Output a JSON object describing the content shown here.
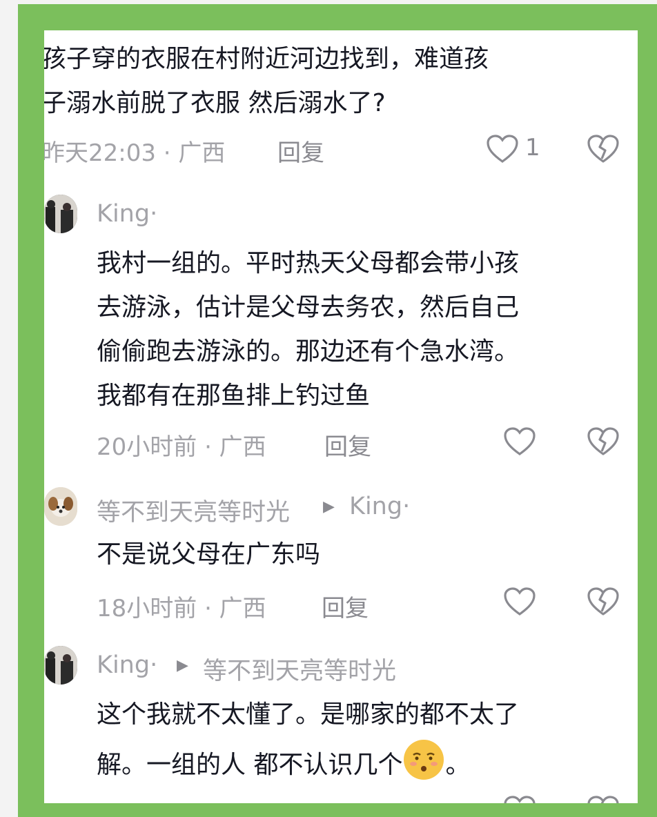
{
  "top_comment": {
    "text_line1": "孩子穿的衣服在村附近河边找到，难道孩",
    "text_line2": "子溺水前脱了衣服 然后溺水了?",
    "time_location": "昨天22:03 · 广西",
    "reply_label": "回复",
    "like_count": "1"
  },
  "replies": [
    {
      "username": "King·",
      "lines": [
        "我村一组的。平时热天父母都会带小孩",
        "去游泳，估计是父母去务农，然后自己",
        "偷偷跑去游泳的。那边还有个急水湾。",
        "我都有在那鱼排上钓过鱼"
      ],
      "time_location": "20小时前 · 广西",
      "reply_label": "回复"
    },
    {
      "username": "等不到天亮等时光",
      "reply_to": "King·",
      "lines": [
        "不是说父母在广东吗"
      ],
      "time_location": "18小时前 · 广西",
      "reply_label": "回复"
    },
    {
      "username": "King·",
      "reply_to": "等不到天亮等时光",
      "lines": [
        "这个我就不太懂了。是哪家的都不太了",
        "解。一组的人 都不认识几个",
        "。"
      ]
    }
  ],
  "icons": {
    "like": "heart-outline-icon",
    "dislike": "broken-heart-icon",
    "reply_arrow": "right-triangle-icon",
    "emoji": "smirk-face-emoji"
  },
  "colors": {
    "frame_green": "#7bbf5c",
    "text": "#161823",
    "meta": "#a3a3a8"
  }
}
